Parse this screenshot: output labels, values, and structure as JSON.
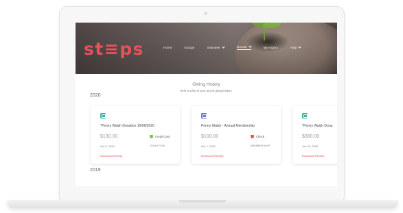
{
  "brand": {
    "logo_text": "st≡ps",
    "accent": "#e8515b"
  },
  "nav": {
    "items": [
      {
        "label": "Home",
        "has_dropdown": false
      },
      {
        "label": "Groups",
        "has_dropdown": false
      },
      {
        "label": "Volunteer",
        "has_dropdown": true
      },
      {
        "label": "Donate",
        "has_dropdown": true
      },
      {
        "label": "My Impact",
        "has_dropdown": false
      },
      {
        "label": "Help",
        "has_dropdown": true
      }
    ]
  },
  "page": {
    "heading": "Giving History",
    "subheading": "Here is a list of your recent giving history."
  },
  "years": [
    "2020",
    "2019"
  ],
  "cards": [
    {
      "icon": "card-icon",
      "icon_color": "#3bb3a4",
      "title": "\"Penny Walsh Donation 10/06/2020",
      "amount": "$130.00",
      "method": "Credit Card",
      "method_icon": "shield-icon",
      "method_color": "#7cc243",
      "date": "Oct 6, 2020",
      "type": "DONATION",
      "link": "Download Receipt"
    },
    {
      "icon": "card-icon",
      "icon_color": "#6b74d6",
      "title": "Penny Walsh - Annual Membership",
      "amount": "$100.00",
      "method": "Check",
      "method_icon": "check-icon",
      "method_color": "#e8515b",
      "date": "Oct 1, 2020",
      "type": "MEMBERSHIP",
      "link": "Download Receipt"
    },
    {
      "icon": "card-icon",
      "icon_color": "#3bb3a4",
      "title": "\"Penny Walsh Dona",
      "amount": "$380.00",
      "method": "",
      "method_icon": "",
      "method_color": "",
      "date": "Jun 22, 2020",
      "type": "",
      "link": "Download Receipt"
    }
  ]
}
